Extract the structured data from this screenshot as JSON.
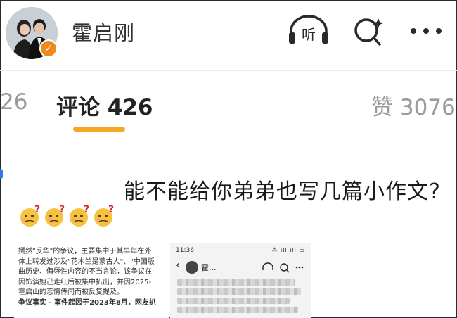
{
  "header": {
    "username": "霍启刚",
    "icons": [
      "avatar",
      "verified-badge-icon",
      "listen-icon",
      "search-icon",
      "more-icon"
    ],
    "listen_label": "听"
  },
  "tabs": {
    "prev_partial": "26",
    "comments": "评论 426",
    "likes": "赞 3076",
    "accent_color": "#f5a623"
  },
  "comment": {
    "text": "能不能给你弟弟也写几篇小作文?",
    "emoji_name": "thinking-face-emoji",
    "emoji_count": 4
  },
  "image_left": {
    "lines": [
      "嫣然\"反华\"的争议，主要集中于其早年在外",
      "体上转发过涉及\"花木兰是蒙古人\"、\"中国版",
      "曲历史、侮辱性内容的不当言论，该争议在",
      "因饰演妲己走红后被集中扒出，并因2025-",
      "霍启山的恋情传闻而被反复提及。",
      "争议事实 - 事件起因于2023年8月，网友扒"
    ]
  },
  "image_right": {
    "time": "11:36",
    "status": "⁂ ıll ıll ▭",
    "back": "‹",
    "name": "霍..."
  }
}
